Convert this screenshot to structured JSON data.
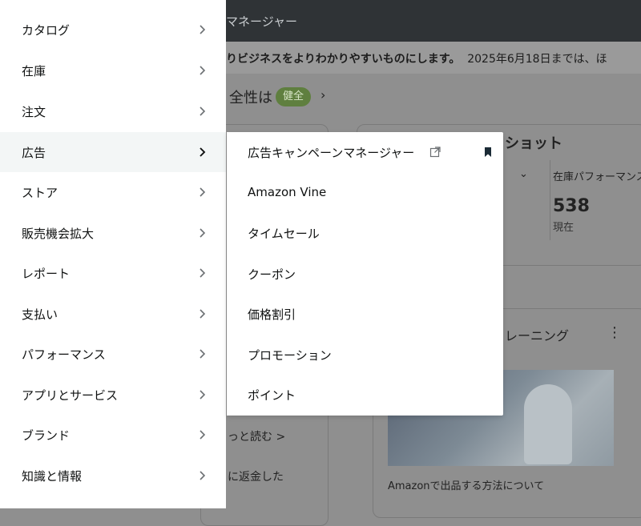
{
  "background": {
    "header_title": "マネージャー",
    "banner_bold": "りビジネスをよりわかりやすいものにします。",
    "banner_text": "2025年6月18日までは、ほ",
    "health_label": "全性は",
    "health_badge": "健全",
    "snapshot_title": "ショット",
    "inventory_label": "在庫パフォーマンス",
    "inventory_value": "538",
    "inventory_sub": "現在",
    "training_title": "レーニング",
    "training_caption": "Amazonで出品する方法について",
    "read_more": "っと読む >",
    "refund_text": "に返金した"
  },
  "nav": {
    "items": [
      {
        "label": "カタログ"
      },
      {
        "label": "在庫"
      },
      {
        "label": "注文"
      },
      {
        "label": "広告"
      },
      {
        "label": "ストア"
      },
      {
        "label": "販売機会拡大"
      },
      {
        "label": "レポート"
      },
      {
        "label": "支払い"
      },
      {
        "label": "パフォーマンス"
      },
      {
        "label": "アプリとサービス"
      },
      {
        "label": "ブランド"
      },
      {
        "label": "知識と情報"
      }
    ],
    "active_index": 3
  },
  "submenu": {
    "items": [
      {
        "label": "広告キャンペーンマネージャー",
        "external": true,
        "bookmarked": true
      },
      {
        "label": "Amazon Vine"
      },
      {
        "label": "タイムセール"
      },
      {
        "label": "クーポン"
      },
      {
        "label": "価格割引"
      },
      {
        "label": "プロモーション"
      },
      {
        "label": "ポイント"
      }
    ]
  },
  "colors": {
    "overlay_bg": "#8f8f8f",
    "topbar": "#2f3336",
    "active_item_bg": "#f3f6f6",
    "badge": "#5f7f3f",
    "text": "#0f1111"
  }
}
